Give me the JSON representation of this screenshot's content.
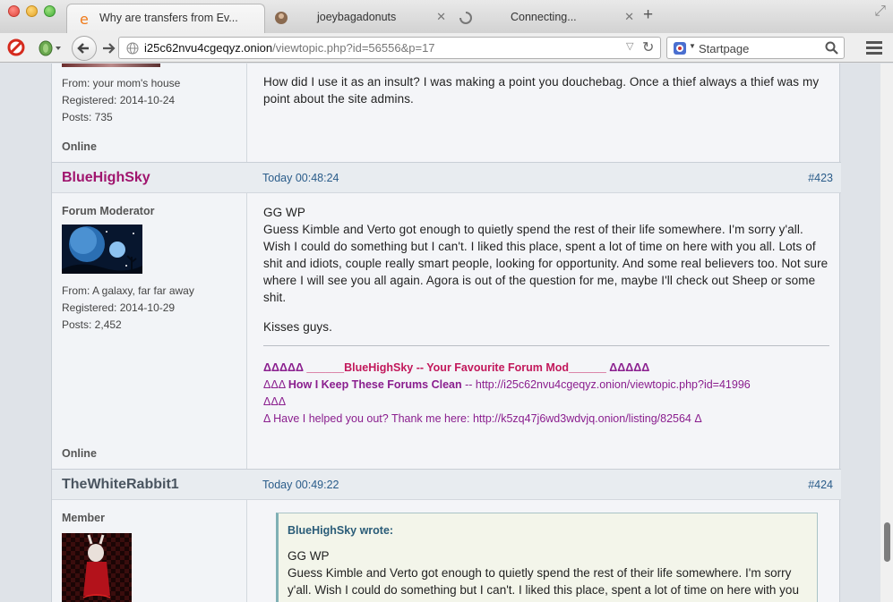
{
  "browser": {
    "tabs": [
      {
        "title": "Why are transfers from Ev...",
        "icon": "e-icon"
      },
      {
        "title": "joeybagadonuts",
        "icon": "avatar-icon"
      },
      {
        "title": "Connecting...",
        "icon": "loading-icon"
      }
    ],
    "url_host": "i25c62nvu4cgeqyz.onion",
    "url_path": "/viewtopic.php?id=56556&p=17",
    "search_placeholder": "Startpage"
  },
  "prev_post": {
    "from": "From: your mom's house",
    "registered": "Registered: 2014-10-24",
    "posts": "Posts: 735",
    "status": "Online",
    "message": "How did I use it as an insult? I was making a point you douchebag. Once a thief always a thief was my point about the site admins."
  },
  "post_423": {
    "username": "BlueHighSky",
    "username_color": "#a0156e",
    "time": "Today 00:48:24",
    "number": "#423",
    "rank": "Forum Moderator",
    "from": "From: A galaxy, far far away",
    "registered": "Registered: 2014-10-29",
    "posts": "Posts: 2,452",
    "status": "Online",
    "line1": "GG WP",
    "paragraph": "Guess Kimble and Verto got enough to quietly spend the rest of their life somewhere. I'm sorry y'all. Wish I could do something but I can't. I liked this place, spent a lot of time on here with you all. Lots of shit and idiots, couple really smart people, looking for opportunity. And some real believers too. Not sure where I will see you all again. Agora is out of the question for me, maybe I'll check out Sheep or some shit.",
    "kisses": "Kisses guys.",
    "sig1_a": "ΔΔΔΔΔ ",
    "sig1_b": "______BlueHighSky -- Your Favourite Forum Mod______",
    "sig1_c": " ΔΔΔΔΔ",
    "sig2_a": "ΔΔΔ  ",
    "sig2_b": "How I Keep These Forums Clean",
    "sig2_c": " -- http://i25c62nvu4cgeqyz.onion/viewtopic.php?id=41996",
    "sig3": "ΔΔΔ",
    "sig4": "Δ Have I helped you out? Thank me here: http://k5zq47j6wd3wdvjq.onion/listing/82564 Δ"
  },
  "post_424": {
    "username": "TheWhiteRabbit1",
    "time": "Today 00:49:22",
    "number": "#424",
    "rank": "Member",
    "quote_author": "BlueHighSky wrote:",
    "quote_line1": "GG WP",
    "quote_paragraph": "Guess Kimble and Verto got enough to quietly spend the rest of their life somewhere. I'm sorry y'all. Wish I could do something but I can't. I liked this place, spent a lot of time on here with you all."
  },
  "colors": {
    "link_blue": "#2a5c8a",
    "signature_purple": "#8a1e8e",
    "signature_pink": "#c2185b"
  }
}
